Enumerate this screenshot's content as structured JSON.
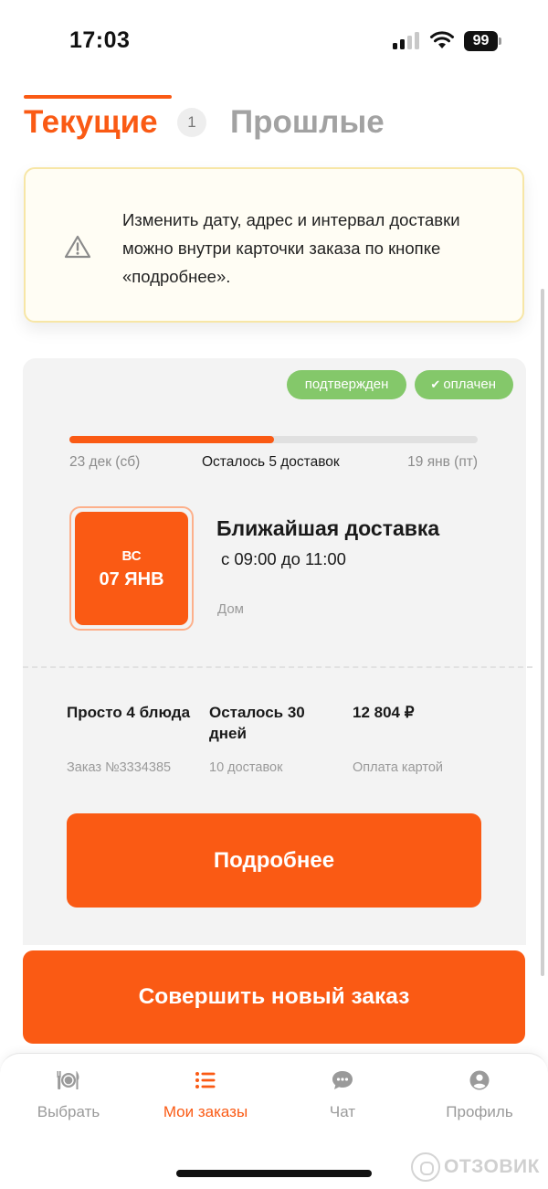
{
  "status_bar": {
    "time": "17:03",
    "battery": "99"
  },
  "tabs": {
    "current_label": "Текущие",
    "current_count": "1",
    "past_label": "Прошлые"
  },
  "notice": {
    "text": "Изменить дату, адрес и интервал доставки можно внутри карточки заказа по кнопке «подробнее»."
  },
  "order": {
    "badges": {
      "confirmed": "подтвержден",
      "paid": "оплачен"
    },
    "progress": {
      "fraction": 0.5,
      "start_label": "23 дек (сб)",
      "middle_label": "Осталось 5 доставок",
      "end_label": "19 янв (пт)"
    },
    "next_delivery": {
      "day": "ВС",
      "date": "07 ЯНВ",
      "title": "Ближайшая доставка",
      "time": "с 09:00 до 11:00",
      "place": "Дом"
    },
    "info": [
      {
        "main": "Просто 4 блюда",
        "sub": "Заказ №3334385"
      },
      {
        "main": "Осталось 30 дней",
        "sub": "10 доставок"
      },
      {
        "main": "12 804 ₽",
        "sub": "Оплата картой"
      }
    ],
    "details_button": "Подробнее"
  },
  "new_order_button": "Совершить новый заказ",
  "bottom_nav": {
    "items": [
      {
        "label": "Выбрать",
        "icon": "plate-icon"
      },
      {
        "label": "Мои заказы",
        "icon": "list-icon"
      },
      {
        "label": "Чат",
        "icon": "chat-icon"
      },
      {
        "label": "Профиль",
        "icon": "profile-icon"
      }
    ],
    "active_index": 1
  },
  "watermark": "ОТЗОВИК",
  "colors": {
    "accent": "#fa5a14",
    "badge_green": "#84c86a",
    "muted_text": "#9a9a9a",
    "notice_bg": "#fffdf4"
  }
}
